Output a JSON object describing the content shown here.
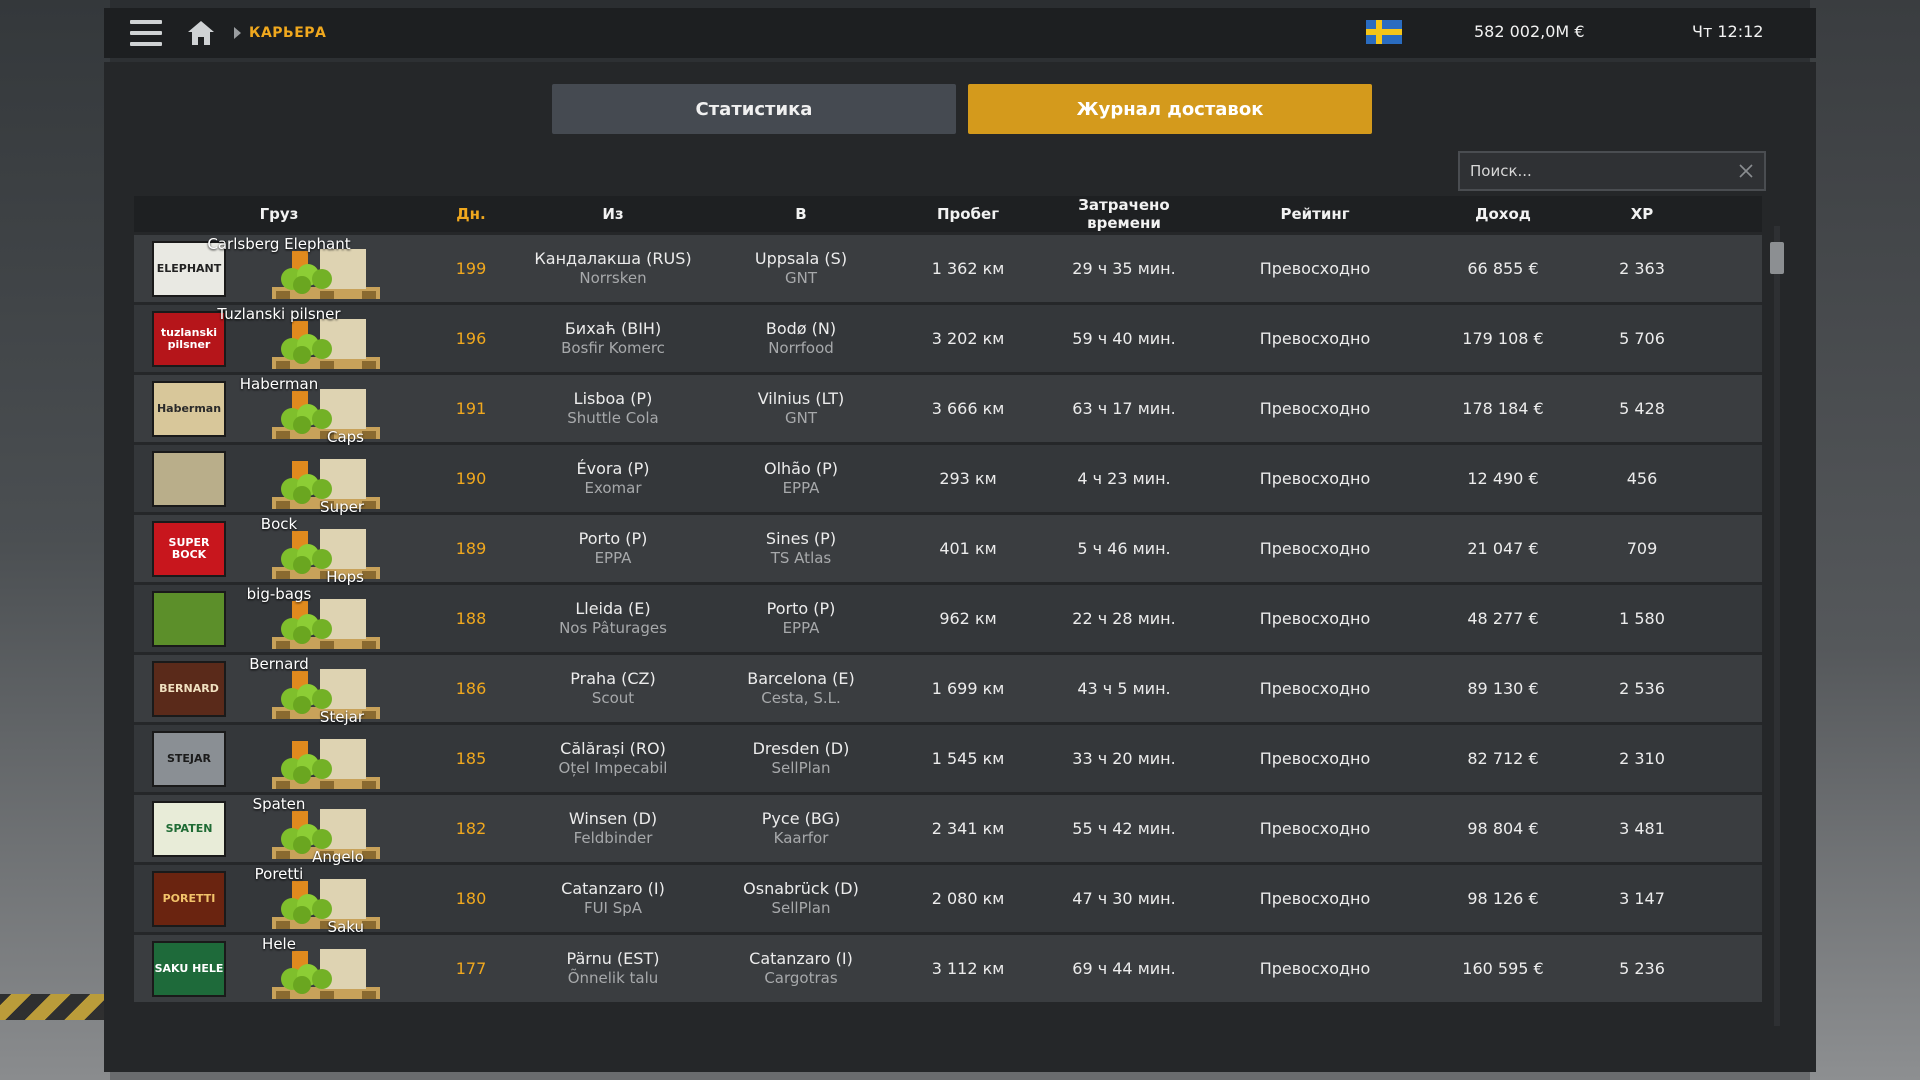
{
  "topbar": {
    "breadcrumb": "КАРЬЕРА",
    "money": "582 002,0M €",
    "time": "Чт 12:12"
  },
  "tabs": {
    "stats": "Статистика",
    "log": "Журнал доставок"
  },
  "search": {
    "placeholder": "Поиск..."
  },
  "columns": {
    "cargo": "Груз",
    "days": "Дн.",
    "from": "Из",
    "to": "В",
    "distance": "Пробег",
    "time": "Затрачено времени",
    "rating": "Рейтинг",
    "income": "Доход",
    "xp": "XP"
  },
  "rows": [
    {
      "logo": "ELEPHANT",
      "logo_bg": "#e9e9e3",
      "logo_fg": "#222",
      "label_top": "Carlsberg Elephant",
      "label_bottom": "",
      "days": "199",
      "from_city": "Кандалакша (RUS)",
      "from_company": "Norrsken",
      "to_city": "Uppsala (S)",
      "to_company": "GNT",
      "distance": "1 362 км",
      "time": "29 ч 35 мин.",
      "rating": "Превосходно",
      "income": "66 855 €",
      "xp": "2 363"
    },
    {
      "logo": "tuzlanski pilsner",
      "logo_bg": "#b5151a",
      "logo_fg": "#fff",
      "label_top": "Tuzlanski pilsner",
      "label_bottom": "",
      "days": "196",
      "from_city": "Бихаћ (BIH)",
      "from_company": "Bosfir Komerc",
      "to_city": "Bodø (N)",
      "to_company": "Norrfood",
      "distance": "3 202 км",
      "time": "59 ч 40 мин.",
      "rating": "Превосходно",
      "income": "179 108 €",
      "xp": "5 706"
    },
    {
      "logo": "Haberman",
      "logo_bg": "#d8c79a",
      "logo_fg": "#2a2a2a",
      "label_top": "Haberman",
      "label_bottom": "Caps",
      "days": "191",
      "from_city": "Lisboa (P)",
      "from_company": "Shuttle Cola",
      "to_city": "Vilnius (LT)",
      "to_company": "GNT",
      "distance": "3 666 км",
      "time": "63 ч 17 мин.",
      "rating": "Превосходно",
      "income": "178 184 €",
      "xp": "5 428"
    },
    {
      "logo": "",
      "logo_bg": "#b9ae8a",
      "logo_fg": "#333",
      "label_top": "",
      "label_bottom": "Super",
      "days": "190",
      "from_city": "Évora (P)",
      "from_company": "Exomar",
      "to_city": "Olhão (P)",
      "to_company": "EPPA",
      "distance": "293 км",
      "time": "4 ч 23 мин.",
      "rating": "Превосходно",
      "income": "12 490 €",
      "xp": "456"
    },
    {
      "logo": "SUPER BOCK",
      "logo_bg": "#c8161d",
      "logo_fg": "#fff",
      "label_top": "Bock",
      "label_bottom": "Hops",
      "days": "189",
      "from_city": "Porto (P)",
      "from_company": "EPPA",
      "to_city": "Sines (P)",
      "to_company": "TS Atlas",
      "distance": "401 км",
      "time": "5 ч 46 мин.",
      "rating": "Превосходно",
      "income": "21 047 €",
      "xp": "709"
    },
    {
      "logo": "",
      "logo_bg": "#5c8f2a",
      "logo_fg": "#fff",
      "label_top": "big-bags",
      "label_bottom": "",
      "days": "188",
      "from_city": "Lleida (E)",
      "from_company": "Nos Pâturages",
      "to_city": "Porto (P)",
      "to_company": "EPPA",
      "distance": "962 км",
      "time": "22 ч 28 мин.",
      "rating": "Превосходно",
      "income": "48 277 €",
      "xp": "1 580"
    },
    {
      "logo": "BERNARD",
      "logo_bg": "#5a2a1a",
      "logo_fg": "#f0e0c0",
      "label_top": "Bernard",
      "label_bottom": "Stejar",
      "days": "186",
      "from_city": "Praha (CZ)",
      "from_company": "Scout",
      "to_city": "Barcelona (E)",
      "to_company": "Cesta, S.L.",
      "distance": "1 699 км",
      "time": "43 ч 5 мин.",
      "rating": "Превосходно",
      "income": "89 130 €",
      "xp": "2 536"
    },
    {
      "logo": "STEJAR",
      "logo_bg": "#8a8f94",
      "logo_fg": "#1b1b1b",
      "label_top": "",
      "label_bottom": "",
      "days": "185",
      "from_city": "Călărași (RO)",
      "from_company": "Oțel Impecabil",
      "to_city": "Dresden (D)",
      "to_company": "SellPlan",
      "distance": "1 545 км",
      "time": "33 ч 20 мин.",
      "rating": "Превосходно",
      "income": "82 712 €",
      "xp": "2 310"
    },
    {
      "logo": "SPATEN",
      "logo_bg": "#e8ecd8",
      "logo_fg": "#1f6b34",
      "label_top": "Spaten",
      "label_bottom": "Angelo",
      "days": "182",
      "from_city": "Winsen (D)",
      "from_company": "Feldbinder",
      "to_city": "Русе (BG)",
      "to_company": "Kaarfor",
      "distance": "2 341 км",
      "time": "55 ч 42 мин.",
      "rating": "Превосходно",
      "income": "98 804 €",
      "xp": "3 481"
    },
    {
      "logo": "PORETTI",
      "logo_bg": "#6a2410",
      "logo_fg": "#f2c36a",
      "label_top": "Poretti",
      "label_bottom": "Saku",
      "days": "180",
      "from_city": "Catanzaro (I)",
      "from_company": "FUI SpA",
      "to_city": "Osnabrück (D)",
      "to_company": "SellPlan",
      "distance": "2 080 км",
      "time": "47 ч 30 мин.",
      "rating": "Превосходно",
      "income": "98 126 €",
      "xp": "3 147"
    },
    {
      "logo": "SAKU HELE",
      "logo_bg": "#1e6a3a",
      "logo_fg": "#fff",
      "label_top": "Hele",
      "label_bottom": "",
      "days": "177",
      "from_city": "Pärnu (EST)",
      "from_company": "Õnnelik talu",
      "to_city": "Catanzaro (I)",
      "to_company": "Cargotras",
      "distance": "3 112 км",
      "time": "69 ч 44 мин.",
      "rating": "Превосходно",
      "income": "160 595 €",
      "xp": "5 236"
    }
  ],
  "colors": {
    "accent": "#f0a81e",
    "tab_active": "#d49a1c",
    "tab_inactive": "#454a51"
  }
}
